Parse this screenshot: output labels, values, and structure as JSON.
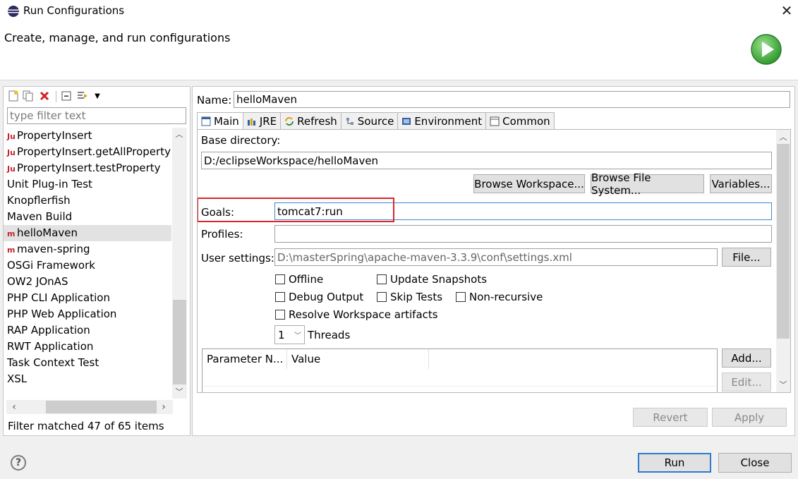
{
  "window": {
    "title": "Run Configurations",
    "banner_text": "Create, manage, and run configurations",
    "colors": {
      "accent": "#2d7bd1",
      "highlight": "#d9272e",
      "run_green": "#3aa83a"
    }
  },
  "left": {
    "filter_placeholder": "type filter text",
    "items": [
      {
        "label": "PropertyInsert",
        "icon": "Ju"
      },
      {
        "label": "PropertyInsert.getAllProperty",
        "icon": "Ju"
      },
      {
        "label": "PropertyInsert.testProperty",
        "icon": "Ju"
      },
      {
        "label": "Unit Plug-in Test",
        "icon": ""
      },
      {
        "label": "Knopflerfish",
        "icon": ""
      },
      {
        "label": "Maven Build",
        "icon": ""
      },
      {
        "label": "helloMaven",
        "icon": "m2",
        "selected": true
      },
      {
        "label": "maven-spring",
        "icon": "m2"
      },
      {
        "label": "OSGi Framework",
        "icon": ""
      },
      {
        "label": "OW2 JOnAS",
        "icon": ""
      },
      {
        "label": "PHP CLI Application",
        "icon": ""
      },
      {
        "label": "PHP Web Application",
        "icon": ""
      },
      {
        "label": "RAP Application",
        "icon": ""
      },
      {
        "label": "RWT Application",
        "icon": ""
      },
      {
        "label": "Task Context Test",
        "icon": ""
      },
      {
        "label": "XSL",
        "icon": ""
      }
    ],
    "status": "Filter matched 47 of 65 items"
  },
  "right": {
    "name_label": "Name:",
    "name_value": "helloMaven",
    "tabs": [
      "Main",
      "JRE",
      "Refresh",
      "Source",
      "Environment",
      "Common"
    ],
    "base_dir_label": "Base directory:",
    "base_dir_value": "D:/eclipseWorkspace/helloMaven",
    "browse_workspace": "Browse Workspace...",
    "browse_fs": "Browse File System...",
    "variables": "Variables...",
    "goals_label": "Goals:",
    "goals_value": "tomcat7:run",
    "profiles_label": "Profiles:",
    "profiles_value": "",
    "user_settings_label": "User settings:",
    "user_settings_value": "D:\\masterSpring\\apache-maven-3.3.9\\conf\\settings.xml",
    "file_button": "File...",
    "checkboxes": {
      "offline": "Offline",
      "update_snapshots": "Update Snapshots",
      "debug_output": "Debug Output",
      "skip_tests": "Skip Tests",
      "non_recursive": "Non-recursive",
      "resolve_workspace": "Resolve Workspace artifacts"
    },
    "threads_value": "1",
    "threads_label": "Threads",
    "param_headers": [
      "Parameter N...",
      "Value"
    ],
    "add_button": "Add...",
    "edit_button": "Edit...",
    "revert_button": "Revert",
    "apply_button": "Apply"
  },
  "footer": {
    "run_button": "Run",
    "close_button": "Close"
  }
}
